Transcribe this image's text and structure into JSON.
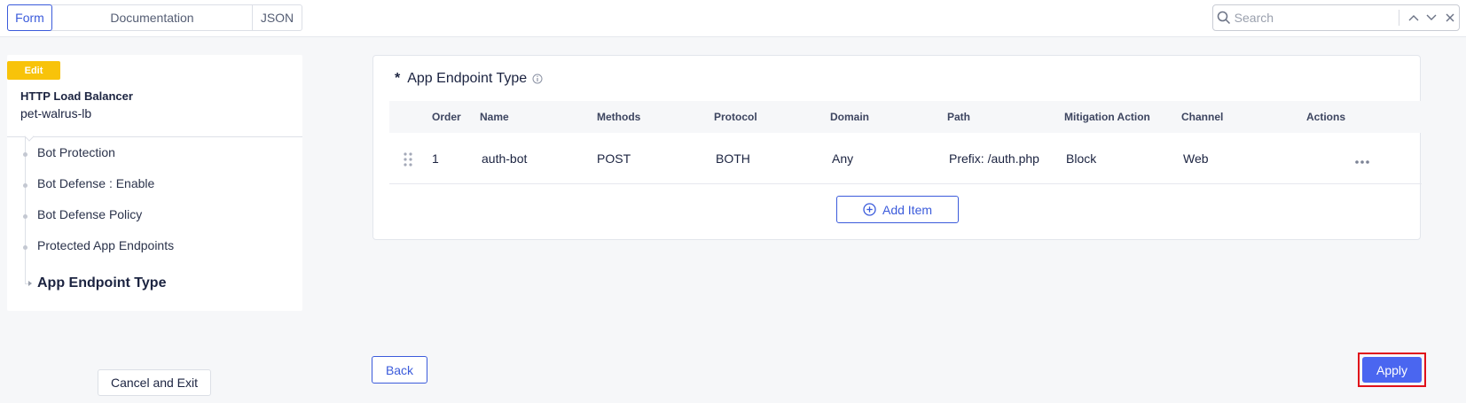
{
  "tabs": {
    "form": "Form",
    "documentation": "Documentation",
    "json": "JSON"
  },
  "search": {
    "placeholder": "Search"
  },
  "sidebar": {
    "badge": "Edit",
    "object_type": "HTTP Load Balancer",
    "object_name": "pet-walrus-lb",
    "items": [
      {
        "label": "Bot Protection"
      },
      {
        "label": "Bot Defense : Enable"
      },
      {
        "label": "Bot Defense Policy"
      },
      {
        "label": "Protected App Endpoints"
      },
      {
        "label": "App Endpoint Type"
      }
    ],
    "cancel_label": "Cancel and Exit"
  },
  "panel": {
    "required_mark": "*",
    "title": "App Endpoint Type",
    "columns": [
      "Order",
      "Name",
      "Methods",
      "Protocol",
      "Domain",
      "Path",
      "Mitigation Action",
      "Channel",
      "Actions"
    ],
    "rows": [
      {
        "order": "1",
        "name": "auth-bot",
        "methods": "POST",
        "protocol": "BOTH",
        "domain": "Any",
        "path": "Prefix: /auth.php",
        "mitigation": "Block",
        "channel": "Web"
      }
    ],
    "add_label": "Add Item"
  },
  "footer": {
    "back_label": "Back",
    "apply_label": "Apply"
  },
  "colors": {
    "accent": "#3b5bdb",
    "apply": "#4a66f0",
    "badge": "#f8c30a",
    "highlight": "#e0101a"
  },
  "icons": [
    "search-icon",
    "chevron-up-icon",
    "chevron-down-icon",
    "close-icon",
    "info-icon",
    "drag-handle-icon",
    "more-dots-icon",
    "plus-circle-icon"
  ]
}
